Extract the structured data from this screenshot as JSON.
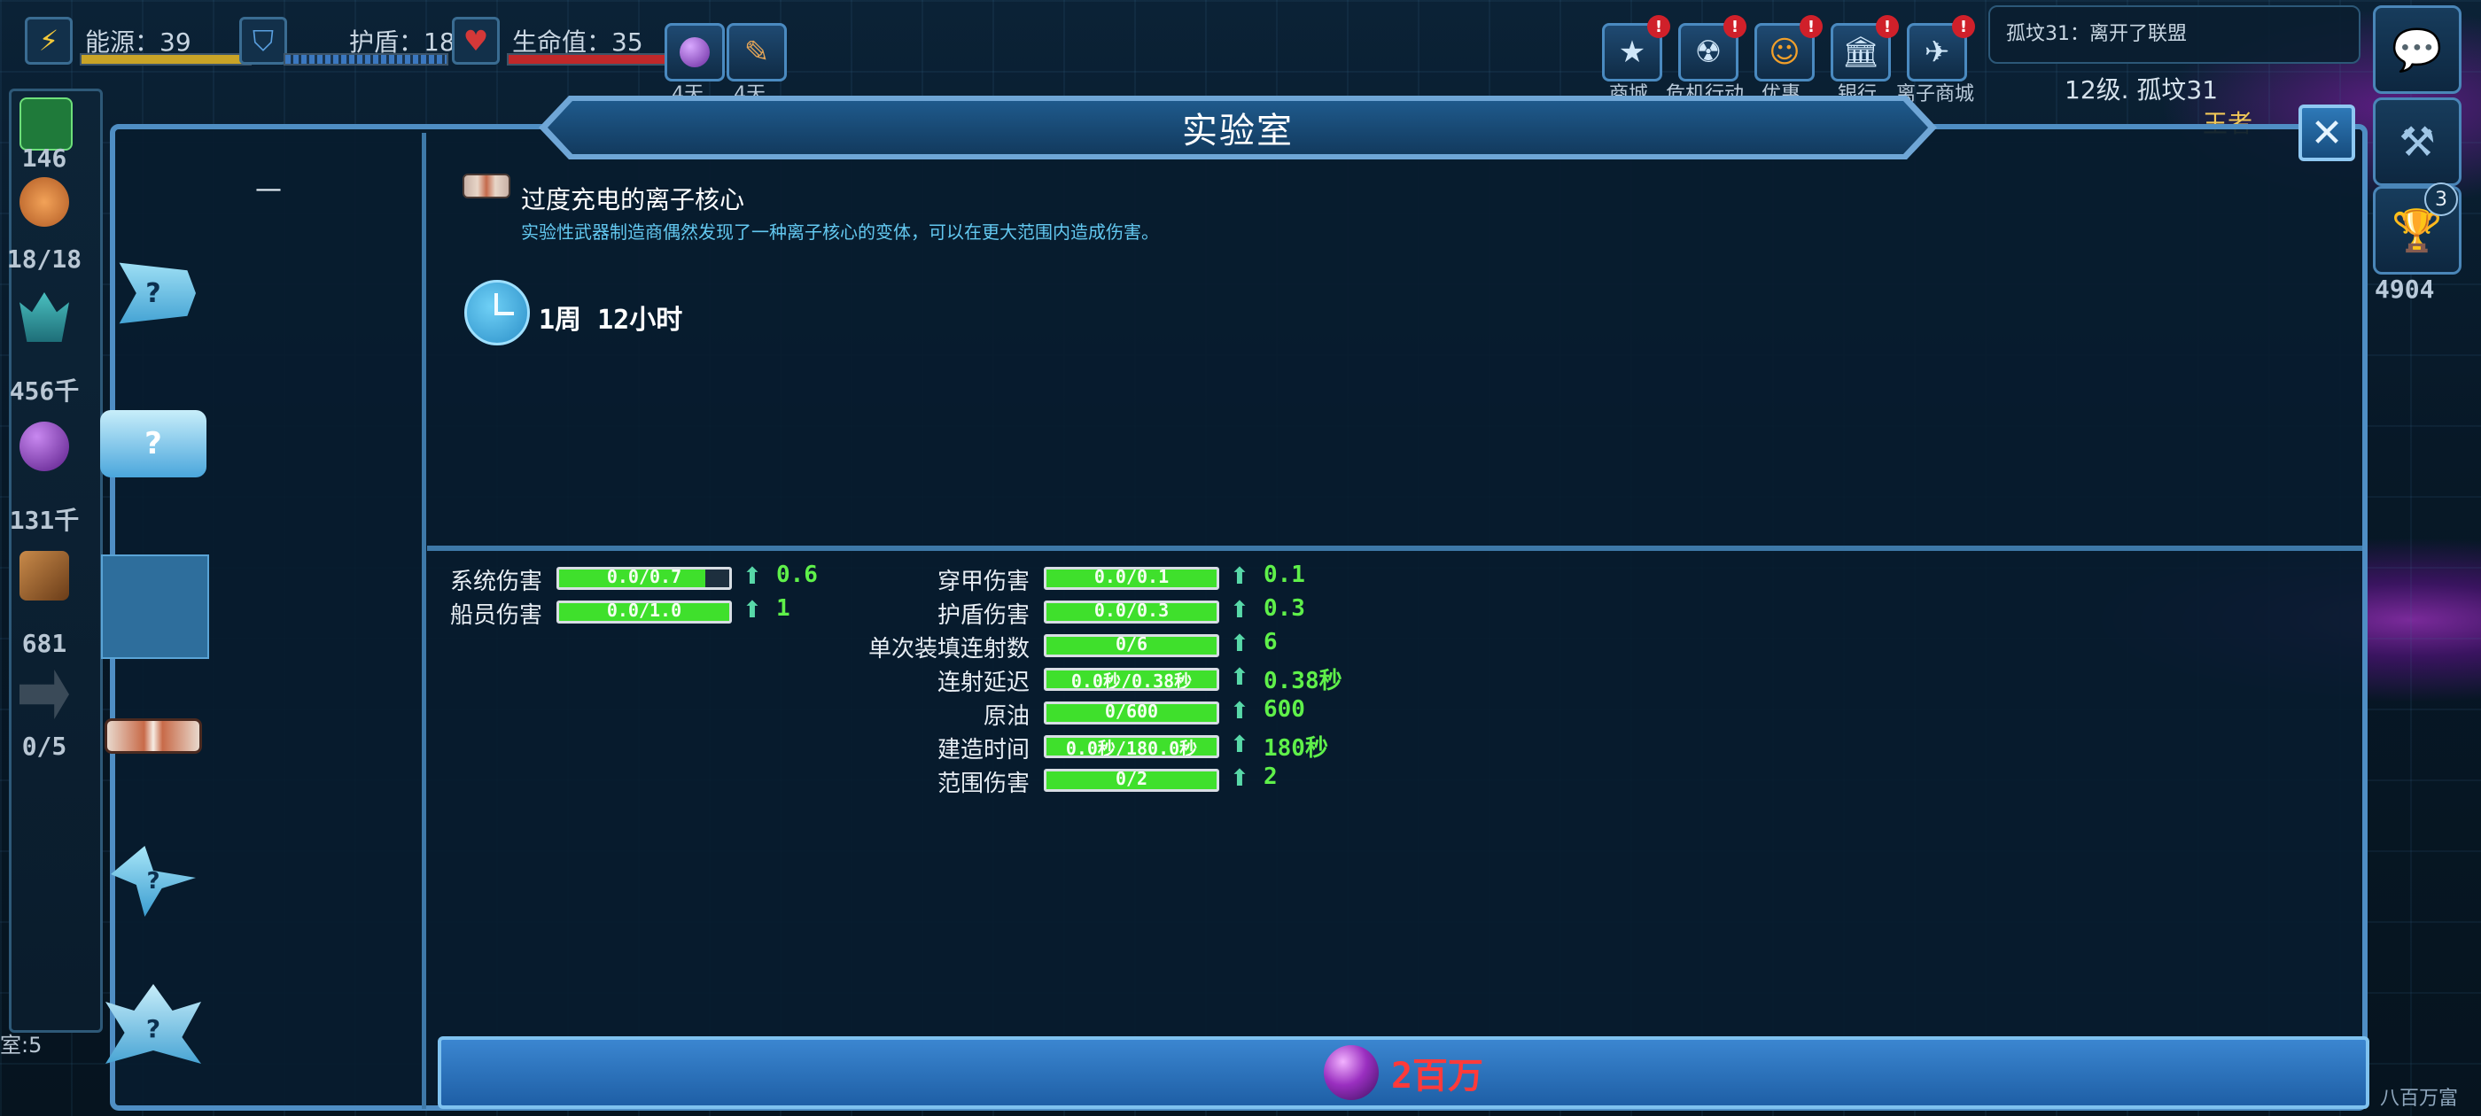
{
  "hud": {
    "energy": {
      "label": "能源：39",
      "level": 0.97,
      "color": "#c9a427"
    },
    "shield": {
      "label": "护盾：18",
      "level": 1.0,
      "color": "#3b78c0"
    },
    "hull": {
      "label": "生命值：35",
      "level": 1.0,
      "color": "#c0282a"
    },
    "boost1_label": "4天",
    "boost2_label": "4天"
  },
  "top_buttons": [
    {
      "label": "商城",
      "icon": "star-icon",
      "alert": "!"
    },
    {
      "label": "危机行动",
      "icon": "radiation-icon",
      "alert": "!"
    },
    {
      "label": "优惠",
      "icon": "smile-icon",
      "alert": "!"
    },
    {
      "label": "银行",
      "icon": "bank-icon",
      "alert": "!"
    },
    {
      "label": "离子商城",
      "icon": "ship-icon",
      "alert": "!"
    }
  ],
  "notice": "孤坟31：离开了联盟",
  "player_line": "12级. 孤坟31",
  "player_sub": "王者",
  "sidebar": {
    "credits": "146",
    "crew": "18/18",
    "minerals": "456千",
    "ions": "131千",
    "materials": "681",
    "drones": "0/5",
    "room": "室:5"
  },
  "trophy_count": "3",
  "score": "4904",
  "bottom_right_hint": "八百万富",
  "dialog": {
    "title": "实验室",
    "dash": "—",
    "item_name": "过度充电的离子核心",
    "item_desc": "实验性武器制造商偶然发现了一种离子核心的变体，可以在更大范围内造成伤害。",
    "time": "1周 12小时",
    "cost": "2百万"
  },
  "stats_left": [
    {
      "label": "系统伤害",
      "bar": "0.0/0.7",
      "fill": 0.86,
      "plus": "0.6"
    },
    {
      "label": "船员伤害",
      "bar": "0.0/1.0",
      "fill": 1.0,
      "plus": "1"
    }
  ],
  "stats_right": [
    {
      "label": "穿甲伤害",
      "bar": "0.0/0.1",
      "fill": 1.0,
      "plus": "0.1"
    },
    {
      "label": "护盾伤害",
      "bar": "0.0/0.3",
      "fill": 1.0,
      "plus": "0.3"
    },
    {
      "label": "单次装填连射数",
      "bar": "0/6",
      "fill": 1.0,
      "plus": "6"
    },
    {
      "label": "连射延迟",
      "bar": "0.0秒/0.38秒",
      "fill": 1.0,
      "plus": "0.38秒"
    },
    {
      "label": "原油",
      "bar": "0/600",
      "fill": 1.0,
      "plus": "600"
    },
    {
      "label": "建造时间",
      "bar": "0.0秒/180.0秒",
      "fill": 1.0,
      "plus": "180秒"
    },
    {
      "label": "范围伤害",
      "bar": "0/2",
      "fill": 1.0,
      "plus": "2"
    }
  ],
  "colors": {
    "accent": "#4f8ec4",
    "stat_green": "#3fe02c",
    "cost_red": "#ff3a3a"
  }
}
